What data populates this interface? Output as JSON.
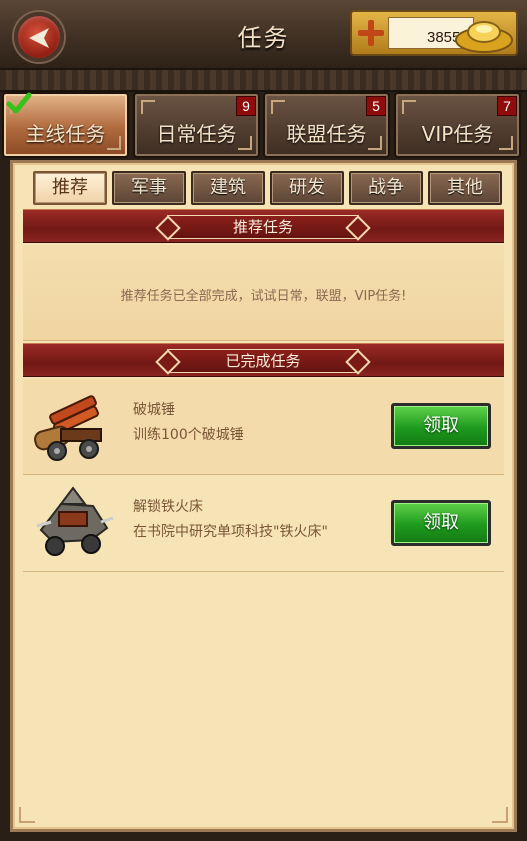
{
  "header": {
    "title": "任务",
    "back_icon": "back-arrow-icon",
    "currency": {
      "amount": "3855812",
      "icon": "gold-ingot-icon",
      "add_icon": "plus-icon"
    }
  },
  "main_tabs": [
    {
      "label": "主线任务",
      "badge": "",
      "active": true
    },
    {
      "label": "日常任务",
      "badge": "9",
      "active": false
    },
    {
      "label": "联盟任务",
      "badge": "5",
      "active": false
    },
    {
      "label": "VIP任务",
      "badge": "7",
      "active": false
    }
  ],
  "sub_tabs": [
    {
      "label": "推荐",
      "active": true
    },
    {
      "label": "军事",
      "active": false
    },
    {
      "label": "建筑",
      "active": false
    },
    {
      "label": "研发",
      "active": false
    },
    {
      "label": "战争",
      "active": false
    },
    {
      "label": "其他",
      "active": false
    }
  ],
  "recommend": {
    "heading": "推荐任务",
    "message": "推荐任务已全部完成，试试日常，联盟，VIP任务!"
  },
  "completed": {
    "heading": "已完成任务",
    "tasks": [
      {
        "name": "破城锤",
        "desc": "训练100个破城锤",
        "button": "领取",
        "icon": "battering-ram-icon"
      },
      {
        "name": "解锁铁火床",
        "desc": "在书院中研究单项科技\"铁火床\"",
        "button": "领取",
        "icon": "war-cart-icon"
      }
    ]
  },
  "colors": {
    "accent_red": "#8a1f1a",
    "claim_green": "#1f9a1e",
    "panel_bg": "#f6e3b6"
  }
}
